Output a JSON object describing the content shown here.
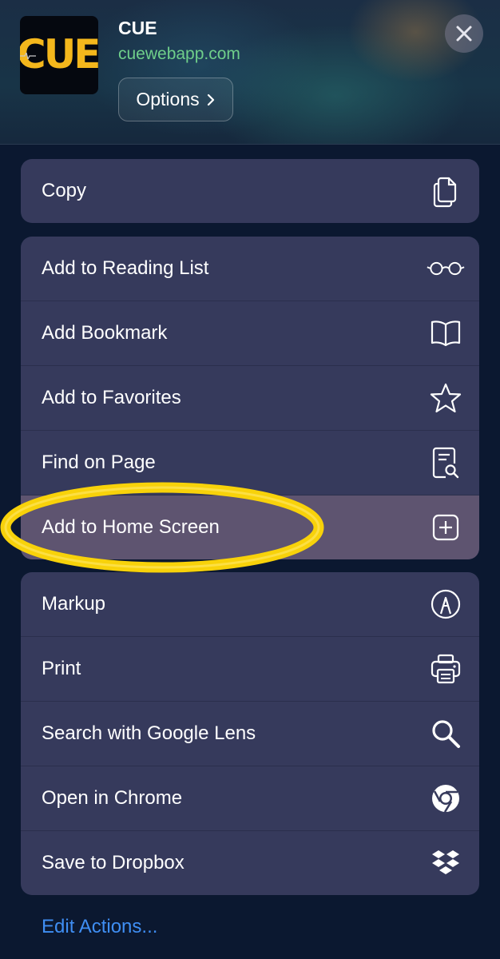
{
  "header": {
    "app_name": "CUE",
    "app_url": "cuewebapp.com",
    "options_label": "Options",
    "app_icon_text": "CUE"
  },
  "groups": [
    {
      "items": [
        {
          "label": "Copy",
          "icon": "copy-icon"
        }
      ]
    },
    {
      "items": [
        {
          "label": "Add to Reading List",
          "icon": "glasses-icon"
        },
        {
          "label": "Add Bookmark",
          "icon": "book-icon"
        },
        {
          "label": "Add to Favorites",
          "icon": "star-icon"
        },
        {
          "label": "Find on Page",
          "icon": "find-on-page-icon"
        },
        {
          "label": "Add to Home Screen",
          "icon": "plus-square-icon",
          "highlighted": true
        }
      ]
    },
    {
      "items": [
        {
          "label": "Markup",
          "icon": "markup-pen-icon"
        },
        {
          "label": "Print",
          "icon": "printer-icon"
        },
        {
          "label": "Search with Google Lens",
          "icon": "magnifier-icon"
        },
        {
          "label": "Open in Chrome",
          "icon": "chrome-icon"
        },
        {
          "label": "Save to Dropbox",
          "icon": "dropbox-icon"
        }
      ]
    }
  ],
  "footer": {
    "edit_actions_label": "Edit Actions..."
  },
  "colors": {
    "background": "#0b1830",
    "group_background": "#363a5c",
    "highlighted_row": "#5e5470",
    "link_blue": "#3f8ef3",
    "url_green": "#6fcf8a",
    "logo_yellow": "#f4b71c",
    "highlight_ring": "#f8d20a"
  }
}
